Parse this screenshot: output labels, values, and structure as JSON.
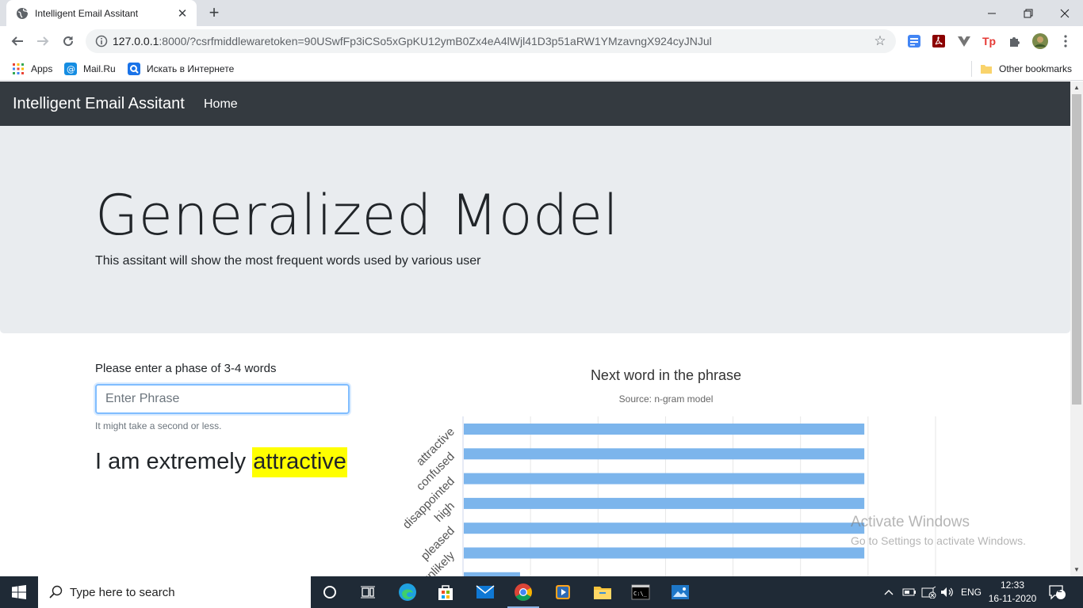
{
  "browser": {
    "tab_title": "Intelligent Email Assitant",
    "new_tab": "+",
    "url_host": "127.0.0.1",
    "url_rest": ":8000/?csrfmiddlewaretoken=90USwfFp3iCSo5xGpKU12ymB0Zx4eA4lWjl41D3p51aRW1YMzavngX924cyJNJul",
    "bookmarks": [
      "Apps",
      "Mail.Ru",
      "Искать в Интернете"
    ],
    "other_bookmarks": "Other bookmarks"
  },
  "navbar": {
    "brand": "Intelligent Email Assitant",
    "home": "Home"
  },
  "jumbotron": {
    "title": "Generalized Model",
    "subtitle": "This assitant will show the most frequent words used by various user"
  },
  "form": {
    "label": "Please enter a phase of 3-4 words",
    "placeholder": "Enter Phrase",
    "help": "It might take a second or less."
  },
  "result": {
    "text": "I am extremely",
    "highlight": "attractive"
  },
  "chart_data": {
    "type": "bar",
    "orientation": "horizontal",
    "title": "Next word in the phrase",
    "subtitle": "Source: n-gram model",
    "categories": [
      "attractive",
      "confused",
      "disappointed",
      "high",
      "pleased",
      "unlikely",
      ""
    ],
    "values": [
      0.89,
      0.89,
      0.89,
      0.89,
      0.89,
      0.89,
      0.125
    ],
    "xlim": [
      0,
      1.05
    ],
    "grid": true,
    "color": "#7cb5ec"
  },
  "watermark": {
    "line1": "Activate Windows",
    "line2": "Go to Settings to activate Windows."
  },
  "taskbar": {
    "search_placeholder": "Type here to search",
    "language": "ENG",
    "time": "12:33",
    "date": "16-11-2020",
    "notifications": "2"
  }
}
